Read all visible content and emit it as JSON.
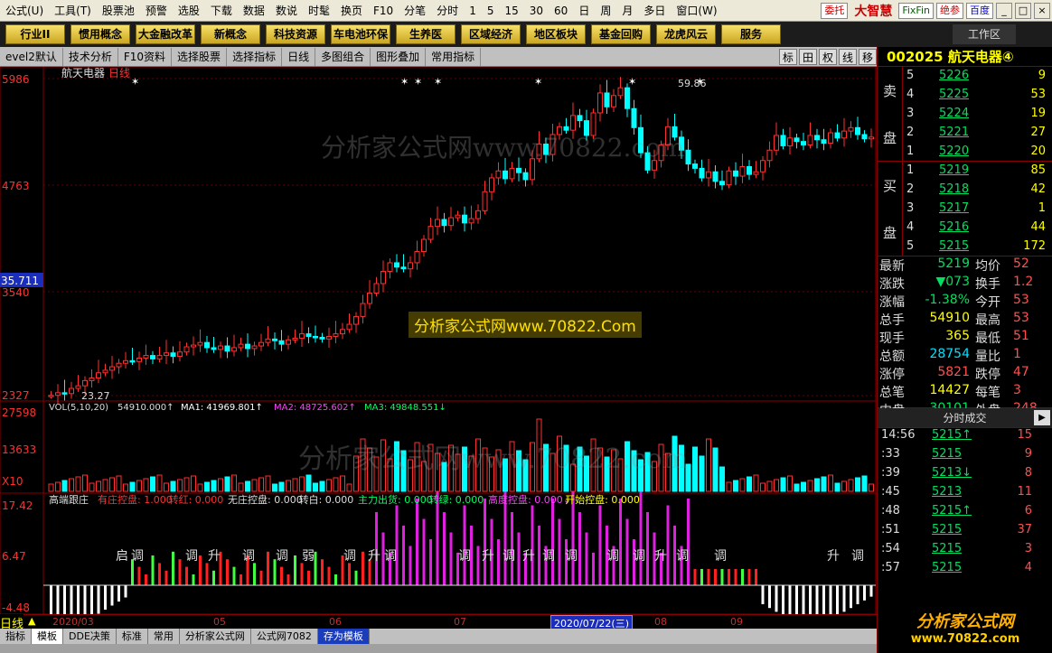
{
  "menu": [
    "公式(U)",
    "工具(T)",
    "股票池",
    "预警",
    "选股",
    "下载",
    "数据",
    "数说",
    "时髦",
    "换页",
    "F10",
    "分笔",
    "分时",
    "1",
    "5",
    "15",
    "30",
    "60",
    "日",
    "周",
    "月",
    "多日",
    "窗口(W)"
  ],
  "menu_right": {
    "badge1": "委托",
    "brand": "大智慧",
    "badge2": "FixFin",
    "badge3": "绝参",
    "badge4": "百度"
  },
  "topbuttons": [
    "行业II",
    "惯用概念",
    "大金融改革",
    "新概念",
    "科技资源",
    "车电池环保",
    "生养医",
    "区域经济",
    "地区板块",
    "基金回购",
    "龙虎风云",
    "服务"
  ],
  "workarea": "工作区",
  "toolbar": {
    "items": [
      "evel2默认",
      "技术分析",
      "F10资料",
      "选择股票",
      "选择指标",
      "日线",
      "多图组合",
      "图形叠加",
      "常用指标"
    ],
    "right": [
      "标",
      "田",
      "权",
      "线",
      "移"
    ]
  },
  "stock": {
    "code": "002025",
    "name": "航天电器④",
    "title_line": "航天电器",
    "period": "日线"
  },
  "price_axis": {
    "labels": [
      "5986",
      "4763",
      "3540",
      "2327"
    ],
    "current": "35.711"
  },
  "price_annotations": {
    "high": "59.86",
    "low": "23.27"
  },
  "vol_header": {
    "label": "VOL(5,10,20)",
    "value": "54910.000↑",
    "ma1": "MA1: 41969.801↑",
    "ma2": "MA2: 48725.602↑",
    "ma3": "MA3: 49848.551↓"
  },
  "vol_axis": {
    "labels": [
      "27598",
      "13633",
      "X10"
    ]
  },
  "ind_header": {
    "name": "高端跟庄",
    "items": [
      "有庄控盘: 1.000",
      "转红: 0.000",
      "无庄控盘: 0.000",
      "转白: 0.000",
      "主力出货: 0.000",
      "转绿: 0.000",
      "高度控盘: 0.000↓",
      "开始控盘: 0.000"
    ]
  },
  "ind_axis": {
    "labels": [
      "17.42",
      "6.47",
      "-4.48"
    ]
  },
  "ind_marks": [
    "启",
    "调",
    "调",
    "升",
    "调",
    "调",
    "弱",
    "调",
    "升",
    "调",
    "调",
    "升",
    "调",
    "升",
    "调",
    "调",
    "调",
    "调",
    "升",
    "调",
    "调",
    "升",
    "调",
    "弱",
    "启",
    "调"
  ],
  "date_axis": {
    "labels": [
      "2020/03",
      "05",
      "06",
      "07",
      "08",
      "09"
    ],
    "cursor": "2020/07/22(三)"
  },
  "bottom_tabs": [
    "指标",
    "模板",
    "DDE决策",
    "标准",
    "常用",
    "分析家公式网",
    "公式网7082",
    "存为模板"
  ],
  "period_label": "日线",
  "watermark": {
    "top": "分析家公式网www.70822.com",
    "vol": "分析家公式网www.70822.com"
  },
  "yellow_tip": "分析家公式网www.70822.Com",
  "orderbook": {
    "sell_label": [
      "卖",
      "盘"
    ],
    "buy_label": [
      "买",
      "盘"
    ],
    "sell": [
      {
        "lvl": "5",
        "price": "5226",
        "vol": "9"
      },
      {
        "lvl": "4",
        "price": "5225",
        "vol": "53"
      },
      {
        "lvl": "3",
        "price": "5224",
        "vol": "19"
      },
      {
        "lvl": "2",
        "price": "5221",
        "vol": "27"
      },
      {
        "lvl": "1",
        "price": "5220",
        "vol": "20"
      }
    ],
    "buy": [
      {
        "lvl": "1",
        "price": "5219",
        "vol": "85"
      },
      {
        "lvl": "2",
        "price": "5218",
        "vol": "42"
      },
      {
        "lvl": "3",
        "price": "5217",
        "vol": "1"
      },
      {
        "lvl": "4",
        "price": "5216",
        "vol": "44"
      },
      {
        "lvl": "5",
        "price": "5215",
        "vol": "172"
      }
    ]
  },
  "stats": [
    {
      "l1": "最新",
      "v1": "5219",
      "c1": "#00e060",
      "l2": "均价",
      "v2": "52"
    },
    {
      "l1": "涨跌",
      "v1": "▼073",
      "c1": "#00e060",
      "l2": "换手",
      "v2": "1.2"
    },
    {
      "l1": "涨幅",
      "v1": "-1.38%",
      "c1": "#00e060",
      "l2": "今开",
      "v2": "53"
    },
    {
      "l1": "总手",
      "v1": "54910",
      "c1": "#ffff00",
      "l2": "最高",
      "v2": "53"
    },
    {
      "l1": "现手",
      "v1": "365",
      "c1": "#ffff00",
      "l2": "最低",
      "v2": "51"
    },
    {
      "l1": "总额",
      "v1": "28754",
      "c1": "#00e0ff",
      "l2": "量比",
      "v2": "1"
    },
    {
      "l1": "涨停",
      "v1": "5821",
      "c1": "#ff5050",
      "l2": "跌停",
      "v2": "47"
    },
    {
      "l1": "总笔",
      "v1": "14427",
      "c1": "#ffff00",
      "l2": "每笔",
      "v2": "3"
    },
    {
      "l1": "内盘",
      "v1": "30101",
      "c1": "#00e060",
      "l2": "外盘",
      "v2": "248"
    }
  ],
  "trades_title": "分时成交",
  "trades": [
    {
      "t": "14:56",
      "p": "5215↑",
      "v": "15"
    },
    {
      "t": ":33",
      "p": "5215",
      "v": "9"
    },
    {
      "t": ":39",
      "p": "5213↓",
      "v": "8"
    },
    {
      "t": ":45",
      "p": "5213",
      "v": "11"
    },
    {
      "t": ":48",
      "p": "5215↑",
      "v": "6"
    },
    {
      "t": ":51",
      "p": "5215",
      "v": "37"
    },
    {
      "t": ":54",
      "p": "5215",
      "v": "3"
    },
    {
      "t": ":57",
      "p": "5215",
      "v": "4"
    }
  ],
  "logo": {
    "main": "分析家公式网",
    "url": "www.70822.com"
  },
  "colors": {
    "up": "#ff3030",
    "down": "#00ffff",
    "ma1": "#ffffff",
    "ma2": "#ffff00",
    "ma3": "#ff40ff",
    "ind_magenta": "#e020e0",
    "ind_green": "#40ff40",
    "ind_red": "#ff2020"
  }
}
